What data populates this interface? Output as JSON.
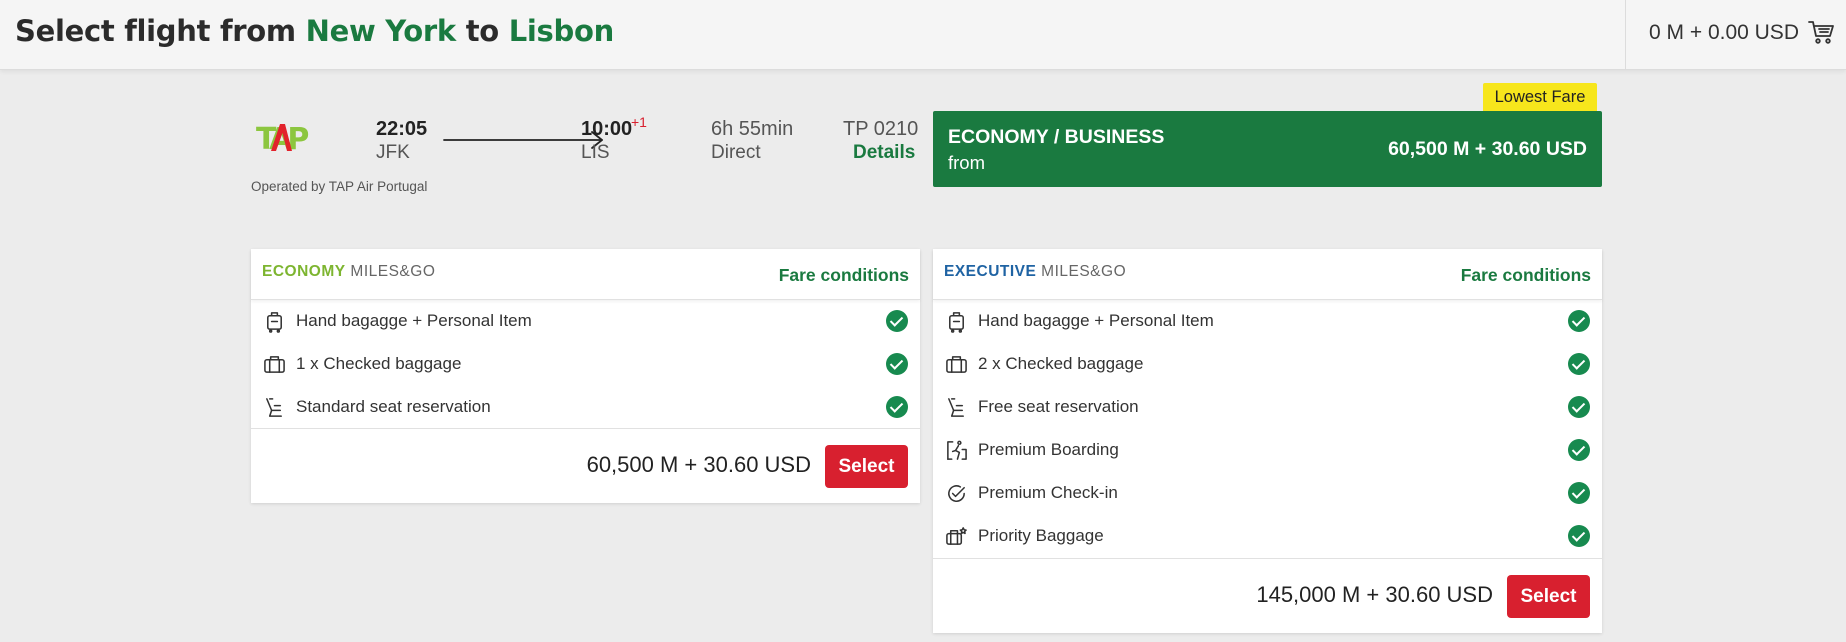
{
  "header": {
    "title_prefix": "Select flight from",
    "origin_city": "New York",
    "connector": "to",
    "destination_city": "Lisbon",
    "cart_total": "0 M + 0.00 USD"
  },
  "flight": {
    "airline_logo_text": "TAP",
    "operated_by": "Operated by TAP Air Portugal",
    "departure_time": "22:05",
    "departure_code": "JFK",
    "arrival_time": "10:00",
    "arrival_day_offset": "+1",
    "arrival_code": "LIS",
    "duration": "6h 55min",
    "stops": "Direct",
    "flight_number": "TP 0210",
    "details_label": "Details"
  },
  "fare_summary": {
    "badge": "Lowest Fare",
    "cabin": "ECONOMY / BUSINESS",
    "from_label": "from",
    "price": "60,500 M + 30.60 USD"
  },
  "fares": [
    {
      "tier": "ECONOMY",
      "programme": "MILES&GO",
      "conditions_label": "Fare conditions",
      "features": [
        {
          "label": "Hand bagagge + Personal Item",
          "icon": "hand-luggage-icon"
        },
        {
          "label": "1 x Checked baggage",
          "icon": "checked-baggage-icon"
        },
        {
          "label": "Standard seat reservation",
          "icon": "seat-icon"
        }
      ],
      "price": "60,500 M + 30.60 USD",
      "select_label": "Select"
    },
    {
      "tier": "EXECUTIVE",
      "programme": "MILES&GO",
      "conditions_label": "Fare conditions",
      "features": [
        {
          "label": "Hand bagagge + Personal Item",
          "icon": "hand-luggage-icon"
        },
        {
          "label": "2 x Checked baggage",
          "icon": "checked-baggage-icon"
        },
        {
          "label": "Free seat reservation",
          "icon": "seat-icon"
        },
        {
          "label": "Premium Boarding",
          "icon": "boarding-icon"
        },
        {
          "label": "Premium Check-in",
          "icon": "check-in-icon"
        },
        {
          "label": "Priority Baggage",
          "icon": "priority-baggage-icon"
        }
      ],
      "price": "145,000 M + 30.60 USD",
      "select_label": "Select"
    }
  ],
  "colors": {
    "brand_green": "#1a7a40",
    "select_red": "#d8202f",
    "badge_yellow": "#f7e61c",
    "economy_green": "#7db530",
    "executive_blue": "#1f63a3",
    "check_green": "#178a4f"
  }
}
